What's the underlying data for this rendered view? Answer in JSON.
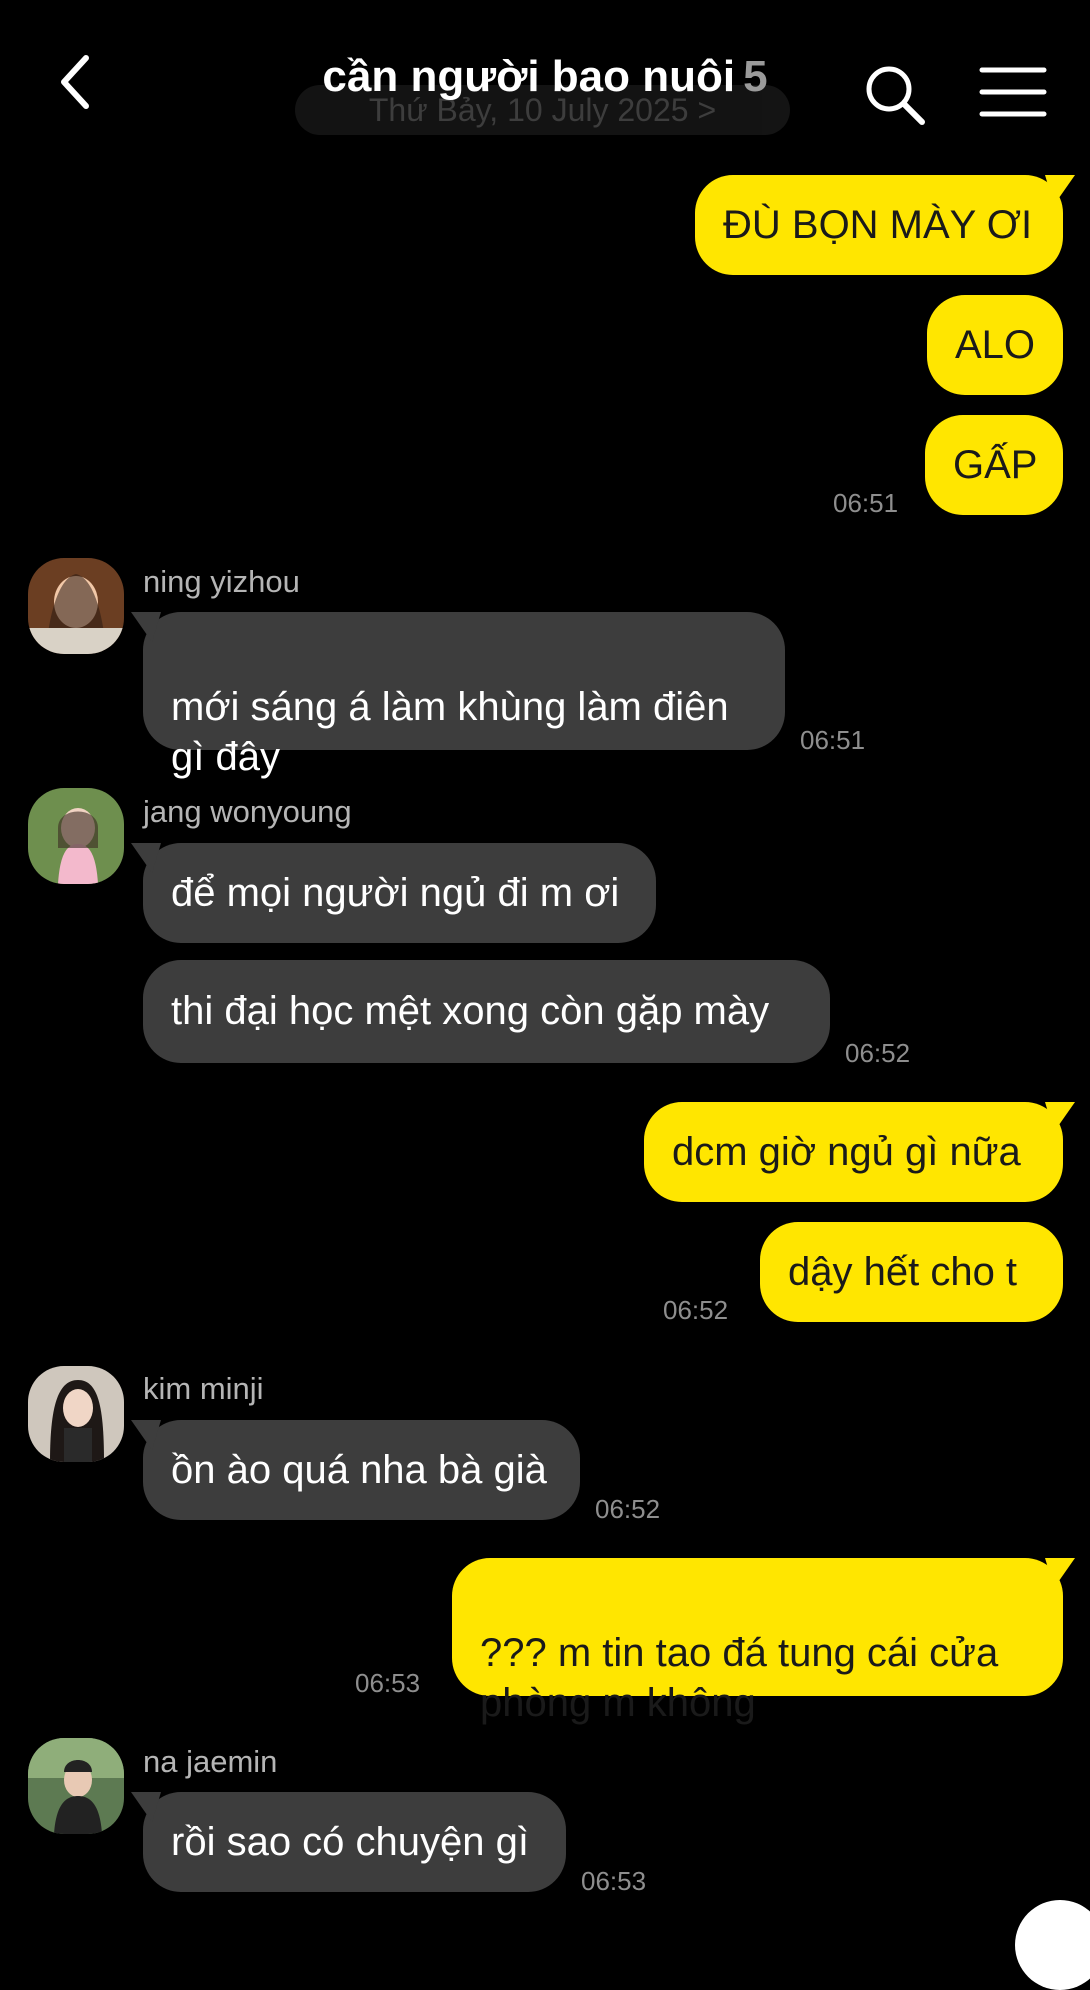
{
  "header": {
    "title": "cần người bao nuôi",
    "member_count": "5",
    "date_pill": "Thứ Bảy, 10 July 2025 >"
  },
  "icons": {
    "back": "chevron-left-icon",
    "search": "search-icon",
    "menu": "menu-icon"
  },
  "colors": {
    "me_bubble": "#ffe600",
    "them_bubble": "#3d3d3d",
    "background": "#000000"
  },
  "messages": [
    {
      "from": "me",
      "text": "ĐÙ BỌN MÀY ƠI"
    },
    {
      "from": "me",
      "text": "ALO"
    },
    {
      "from": "me",
      "text": "GẤP",
      "time": "06:51"
    },
    {
      "from": "ning yizhou",
      "text": "mới sáng á làm khùng làm điên\ngì đây",
      "time": "06:51"
    },
    {
      "from": "jang wonyoung",
      "text": "để mọi người ngủ đi m ơi"
    },
    {
      "from": "jang wonyoung",
      "text": "thi đại học mệt xong còn gặp mày",
      "time": "06:52"
    },
    {
      "from": "me",
      "text": "dcm giờ ngủ gì nữa"
    },
    {
      "from": "me",
      "text": "dậy hết cho t",
      "time": "06:52"
    },
    {
      "from": "kim minji",
      "text": "ồn ào quá nha bà già",
      "time": "06:52"
    },
    {
      "from": "me",
      "text": "??? m tin tao đá tung cái cửa\nphòng m không",
      "time": "06:53"
    },
    {
      "from": "na jaemin",
      "text": "rồi sao có chuyện gì",
      "time": "06:53"
    }
  ]
}
